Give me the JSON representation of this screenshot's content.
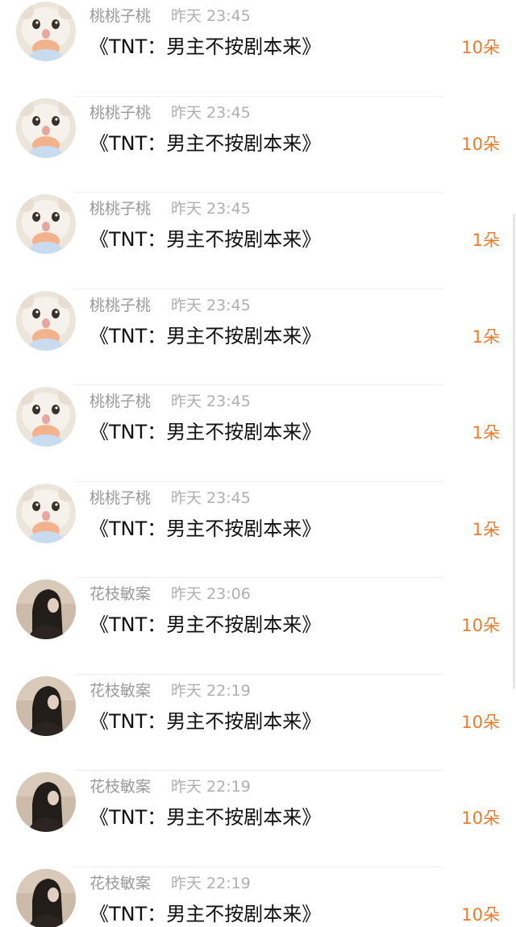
{
  "entries": [
    {
      "user": "桃桃子桃",
      "time": "昨天 23:45",
      "book": "《TNT：男主不按剧本来》",
      "flowers": "10朵",
      "avatar": "cat-avatar"
    },
    {
      "user": "桃桃子桃",
      "time": "昨天 23:45",
      "book": "《TNT：男主不按剧本来》",
      "flowers": "10朵",
      "avatar": "cat-avatar"
    },
    {
      "user": "桃桃子桃",
      "time": "昨天 23:45",
      "book": "《TNT：男主不按剧本来》",
      "flowers": "1朵",
      "avatar": "cat-avatar"
    },
    {
      "user": "桃桃子桃",
      "time": "昨天 23:45",
      "book": "《TNT：男主不按剧本来》",
      "flowers": "1朵",
      "avatar": "cat-avatar"
    },
    {
      "user": "桃桃子桃",
      "time": "昨天 23:45",
      "book": "《TNT：男主不按剧本来》",
      "flowers": "1朵",
      "avatar": "cat-avatar"
    },
    {
      "user": "桃桃子桃",
      "time": "昨天 23:45",
      "book": "《TNT：男主不按剧本来》",
      "flowers": "1朵",
      "avatar": "cat-avatar"
    },
    {
      "user": "花枝敏案",
      "time": "昨天 23:06",
      "book": "《TNT：男主不按剧本来》",
      "flowers": "10朵",
      "avatar": "girl-avatar"
    },
    {
      "user": "花枝敏案",
      "time": "昨天 22:19",
      "book": "《TNT：男主不按剧本来》",
      "flowers": "10朵",
      "avatar": "girl-avatar"
    },
    {
      "user": "花枝敏案",
      "time": "昨天 22:19",
      "book": "《TNT：男主不按剧本来》",
      "flowers": "10朵",
      "avatar": "girl-avatar"
    },
    {
      "user": "花枝敏案",
      "time": "昨天 22:19",
      "book": "《TNT：男主不按剧本来》",
      "flowers": "10朵",
      "avatar": "girl-avatar"
    }
  ],
  "colors": {
    "flowers": "#f07a2a",
    "username": "#9a9a9a",
    "time": "#b0b0b0",
    "title": "#111111"
  }
}
